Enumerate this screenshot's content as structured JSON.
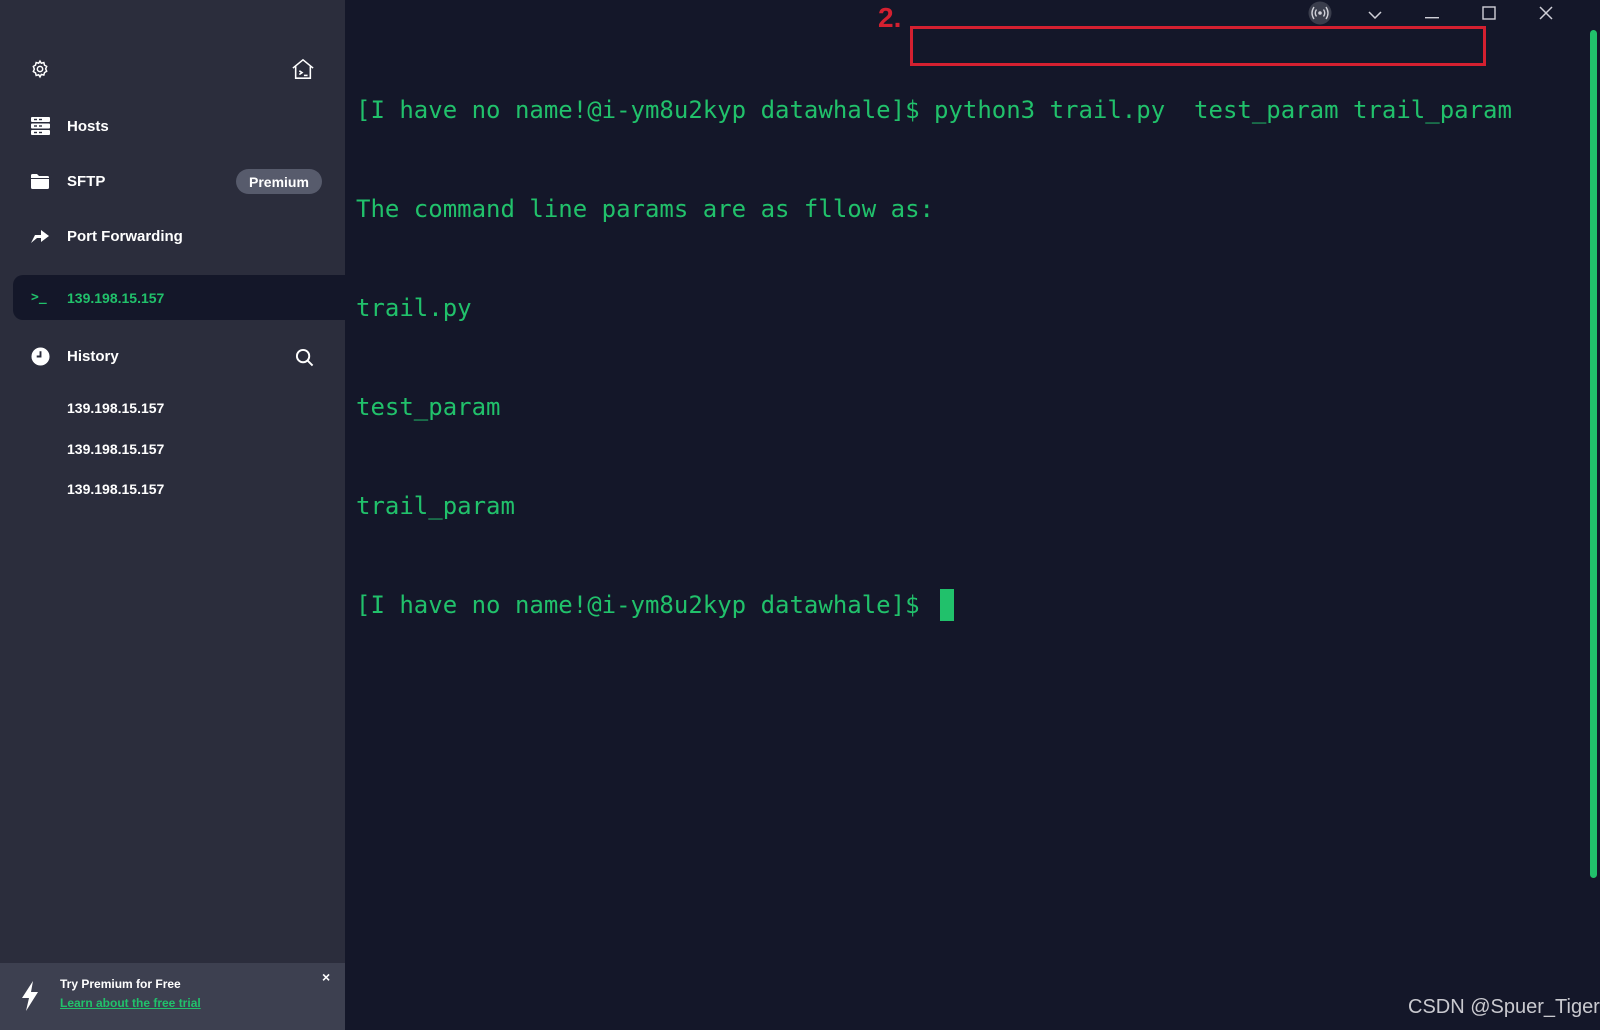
{
  "sidebar": {
    "settings_icon": "gear-icon",
    "home_icon": "home-terminal-icon",
    "nav": {
      "hosts": {
        "label": "Hosts",
        "icon": "hosts-grid-icon"
      },
      "sftp": {
        "label": "SFTP",
        "icon": "folder-icon",
        "badge": "Premium"
      },
      "port_forwarding": {
        "label": "Port Forwarding",
        "icon": "forward-arrow-icon"
      }
    },
    "active_session": {
      "label": "139.198.15.157",
      "icon": "terminal-prompt-icon",
      "prompt_glyph": ">_"
    },
    "history": {
      "label": "History",
      "icon": "clock-icon",
      "search_icon": "search-icon",
      "items": [
        "139.198.15.157",
        "139.198.15.157",
        "139.198.15.157"
      ]
    },
    "promo": {
      "title": "Try Premium for Free",
      "link": "Learn about the free trial",
      "close": "×",
      "icon": "lightning-icon"
    }
  },
  "terminal": {
    "lines": [
      "[I have no name!@i-ym8u2kyp datawhale]$ python3 trail.py  test_param trail_param",
      "The command line params are as fllow as:",
      "trail.py",
      "test_param",
      "trail_param",
      "[I have no name!@i-ym8u2kyp datawhale]$ "
    ],
    "annotation": {
      "step_label": "2."
    },
    "window_controls": [
      "broadcast-icon",
      "chevron-down-icon",
      "minimize-icon",
      "maximize-icon",
      "close-icon"
    ]
  },
  "watermark": "CSDN @Spuer_Tiger",
  "colors": {
    "sidebar_bg": "#2b2d3c",
    "terminal_bg": "#141729",
    "accent_green": "#21c16b",
    "annotation_red": "#d42030",
    "badge_bg": "#575b6c",
    "promo_bg": "#3d4050"
  }
}
